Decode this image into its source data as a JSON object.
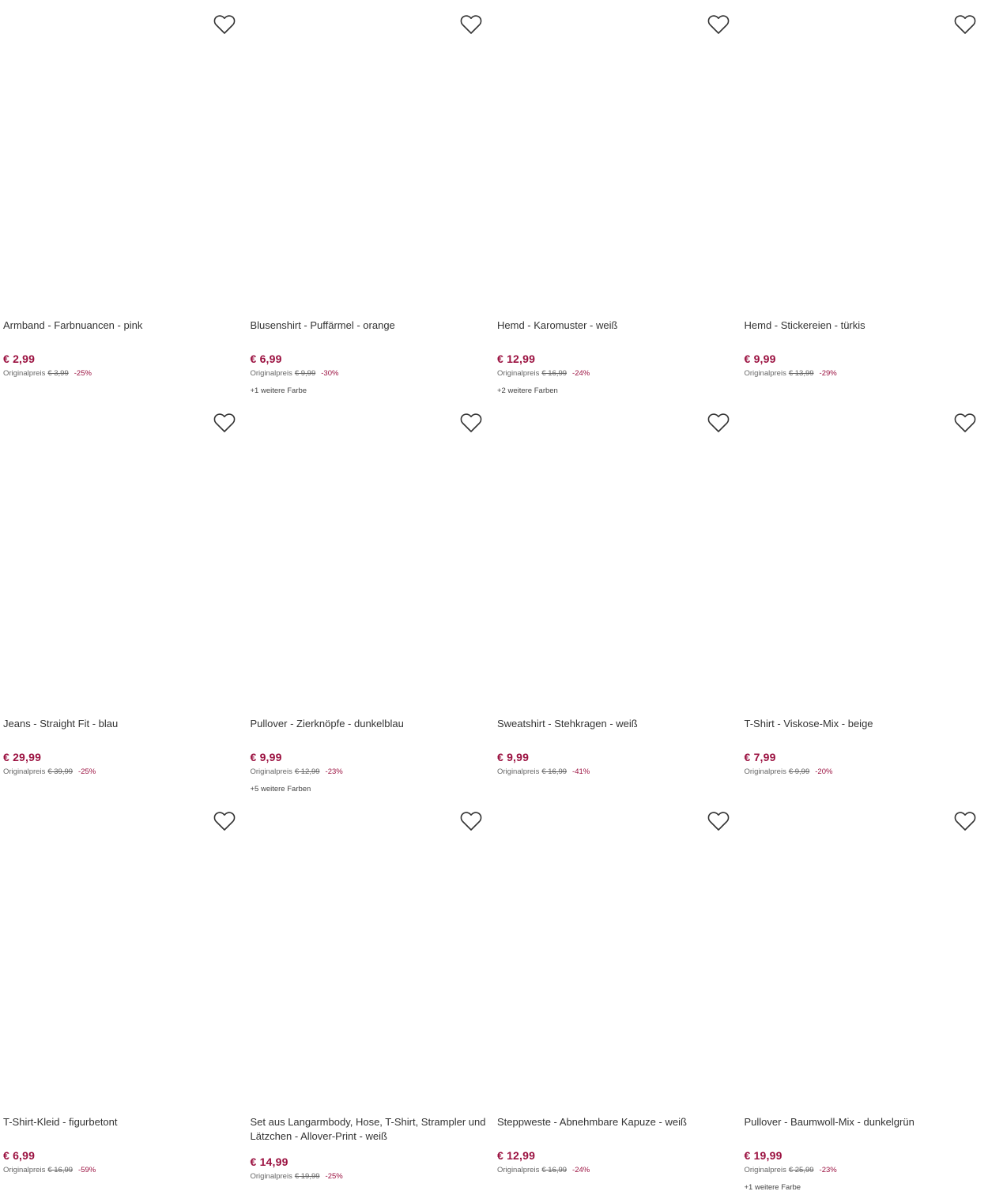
{
  "labels": {
    "original_price_label": "Originalpreis"
  },
  "colors": {
    "price": "#9b1140",
    "text": "#333333"
  },
  "products": [
    {
      "title": "Armband - Farbnuancen - pink",
      "price": "€ 2,99",
      "original": "€ 3,99",
      "discount": "-25%",
      "more_colors": ""
    },
    {
      "title": "Blusenshirt - Puffärmel - orange",
      "price": "€ 6,99",
      "original": "€ 9,99",
      "discount": "-30%",
      "more_colors": "+1 weitere Farbe"
    },
    {
      "title": "Hemd - Karomuster - weiß",
      "price": "€ 12,99",
      "original": "€ 16,99",
      "discount": "-24%",
      "more_colors": "+2 weitere Farben"
    },
    {
      "title": "Hemd - Stickereien - türkis",
      "price": "€ 9,99",
      "original": "€ 13,99",
      "discount": "-29%",
      "more_colors": ""
    },
    {
      "title": "Jeans - Straight Fit - blau",
      "price": "€ 29,99",
      "original": "€ 39,99",
      "discount": "-25%",
      "more_colors": ""
    },
    {
      "title": "Pullover - Zierknöpfe - dunkelblau",
      "price": "€ 9,99",
      "original": "€ 12,99",
      "discount": "-23%",
      "more_colors": "+5 weitere Farben"
    },
    {
      "title": "Sweatshirt - Stehkragen - weiß",
      "price": "€ 9,99",
      "original": "€ 16,99",
      "discount": "-41%",
      "more_colors": ""
    },
    {
      "title": "T-Shirt - Viskose-Mix - beige",
      "price": "€ 7,99",
      "original": "€ 9,99",
      "discount": "-20%",
      "more_colors": ""
    },
    {
      "title": "T-Shirt-Kleid - figurbetont",
      "price": "€ 6,99",
      "original": "€ 16,99",
      "discount": "-59%",
      "more_colors": ""
    },
    {
      "title": "Set aus Langarmbody, Hose, T-Shirt, Strampler und Lätzchen - Allover-Print - weiß",
      "price": "€ 14,99",
      "original": "€ 19,99",
      "discount": "-25%",
      "more_colors": ""
    },
    {
      "title": "Steppweste - Abnehmbare Kapuze - weiß",
      "price": "€ 12,99",
      "original": "€ 16,99",
      "discount": "-24%",
      "more_colors": ""
    },
    {
      "title": "Pullover - Baumwoll-Mix - dunkelgrün",
      "price": "€ 19,99",
      "original": "€ 25,99",
      "discount": "-23%",
      "more_colors": "+1 weitere Farbe"
    }
  ]
}
